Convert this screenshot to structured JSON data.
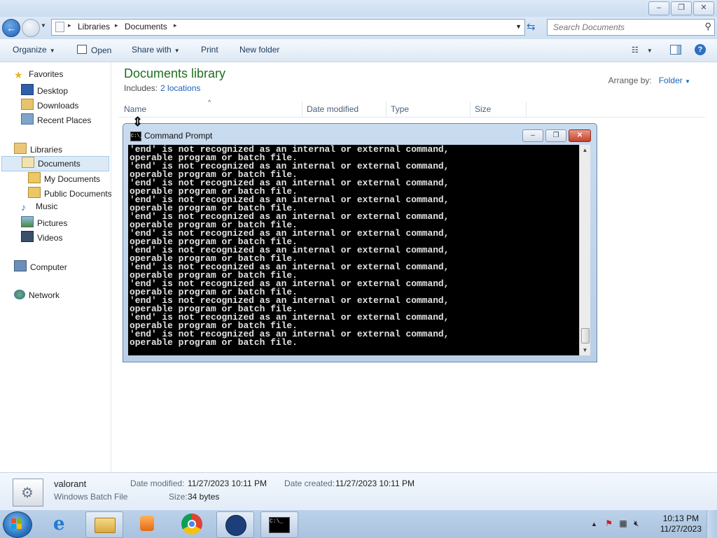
{
  "window": {
    "minimize": "–",
    "maximize": "❐",
    "close": "✕"
  },
  "address": {
    "crumbs": [
      "Libraries",
      "Documents"
    ],
    "separator": "▸",
    "search_placeholder": "Search Documents"
  },
  "toolbar": {
    "organize": "Organize",
    "open": "Open",
    "share_with": "Share with",
    "print": "Print",
    "new_folder": "New folder"
  },
  "nav": {
    "favorites": "Favorites",
    "desktop": "Desktop",
    "downloads": "Downloads",
    "recent_places": "Recent Places",
    "libraries": "Libraries",
    "documents": "Documents",
    "my_documents": "My Documents",
    "public_documents": "Public Documents",
    "music": "Music",
    "pictures": "Pictures",
    "videos": "Videos",
    "computer": "Computer",
    "network": "Network"
  },
  "library": {
    "title": "Documents library",
    "includes_label": "Includes:",
    "includes_link": "2 locations",
    "arrange_label": "Arrange by:",
    "arrange_value": "Folder"
  },
  "columns": {
    "name": "Name",
    "date_modified": "Date modified",
    "type": "Type",
    "size": "Size"
  },
  "cmd": {
    "title": "Command Prompt",
    "icon_text": "C:\\_",
    "lines": [
      "'end' is not recognized as an internal or external command,",
      "operable program or batch file.",
      "'end' is not recognized as an internal or external command,",
      "operable program or batch file.",
      "'end' is not recognized as an internal or external command,",
      "operable program or batch file.",
      "'end' is not recognized as an internal or external command,",
      "operable program or batch file.",
      "'end' is not recognized as an internal or external command,",
      "operable program or batch file.",
      "'end' is not recognized as an internal or external command,",
      "operable program or batch file.",
      "'end' is not recognized as an internal or external command,",
      "operable program or batch file.",
      "'end' is not recognized as an internal or external command,",
      "operable program or batch file.",
      "'end' is not recognized as an internal or external command,",
      "operable program or batch file.",
      "'end' is not recognized as an internal or external command,",
      "operable program or batch file.",
      "'end' is not recognized as an internal or external command,",
      "operable program or batch file.",
      "'end' is not recognized as an internal or external command,",
      "operable program or batch file."
    ]
  },
  "details": {
    "file_name": "valorant",
    "file_type": "Windows Batch File",
    "date_modified_label": "Date modified:",
    "date_modified_value": "11/27/2023 10:11 PM",
    "date_created_label": "Date created:",
    "date_created_value": "11/27/2023 10:11 PM",
    "size_label": "Size:",
    "size_value": "34 bytes"
  },
  "taskbar": {
    "clock_time": "10:13 PM",
    "clock_date": "11/27/2023",
    "cmd_icon_text": "C:\\_"
  },
  "icons": {
    "back": "back-arrow-icon",
    "forward": "forward-arrow-icon",
    "refresh": "refresh-icon",
    "search": "search-icon",
    "help": "help-icon"
  },
  "colors": {
    "library_title": "#1e6f1e",
    "link": "#1f63b8",
    "console_bg": "#000000",
    "console_text": "#e2e2e2"
  }
}
